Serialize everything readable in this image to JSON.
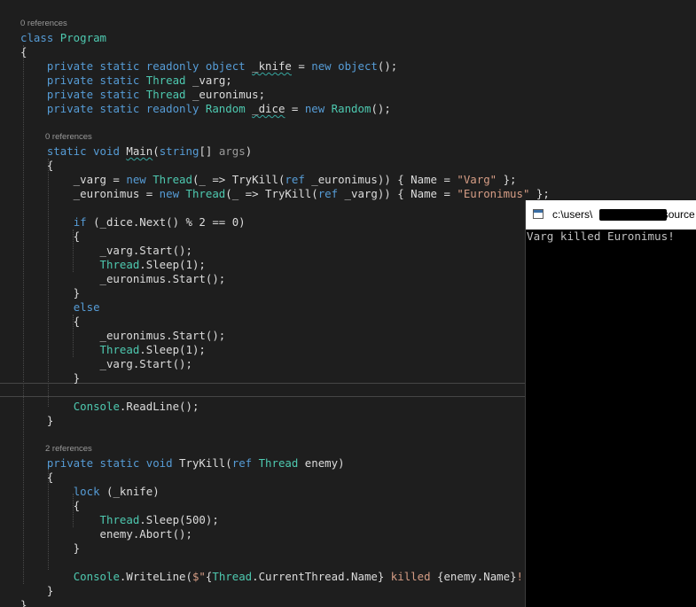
{
  "editor": {
    "colors": {
      "background": "#1e1e1e",
      "keyword": "#569cd6",
      "type": "#4ec9b0",
      "string": "#d69d85",
      "text": "#dcdcdc",
      "parameter": "#9b9b9b",
      "codelens": "#999999"
    },
    "lines": [
      {
        "tokens": [
          {
            "t": "0 references",
            "c": "lens"
          }
        ]
      },
      {
        "tokens": [
          {
            "t": "class ",
            "c": "kw"
          },
          {
            "t": "Program",
            "c": "type"
          }
        ]
      },
      {
        "tokens": [
          {
            "t": "{",
            "c": "p"
          }
        ]
      },
      {
        "tokens": [
          {
            "t": "    ",
            "c": "p"
          },
          {
            "t": "private static readonly object ",
            "c": "kw"
          },
          {
            "t": "_knife",
            "c": "sq"
          },
          {
            "t": " = ",
            "c": "p"
          },
          {
            "t": "new object",
            "c": "kw"
          },
          {
            "t": "();",
            "c": "p"
          }
        ]
      },
      {
        "tokens": [
          {
            "t": "    ",
            "c": "p"
          },
          {
            "t": "private static ",
            "c": "kw"
          },
          {
            "t": "Thread",
            "c": "type"
          },
          {
            "t": " _varg;",
            "c": "p"
          }
        ]
      },
      {
        "tokens": [
          {
            "t": "    ",
            "c": "p"
          },
          {
            "t": "private static ",
            "c": "kw"
          },
          {
            "t": "Thread",
            "c": "type"
          },
          {
            "t": " _euronimus;",
            "c": "p"
          }
        ]
      },
      {
        "tokens": [
          {
            "t": "    ",
            "c": "p"
          },
          {
            "t": "private static readonly ",
            "c": "kw"
          },
          {
            "t": "Random",
            "c": "type"
          },
          {
            "t": " ",
            "c": "p"
          },
          {
            "t": "_dice",
            "c": "sq"
          },
          {
            "t": " = ",
            "c": "p"
          },
          {
            "t": "new ",
            "c": "kw"
          },
          {
            "t": "Random",
            "c": "type"
          },
          {
            "t": "();",
            "c": "p"
          }
        ]
      },
      {
        "tokens": []
      },
      {
        "tokens": [
          {
            "t": "0 references",
            "c": "lens"
          }
        ]
      },
      {
        "tokens": [
          {
            "t": "    ",
            "c": "p"
          },
          {
            "t": "static void ",
            "c": "kw"
          },
          {
            "t": "Main",
            "c": "sqp"
          },
          {
            "t": "(",
            "c": "p"
          },
          {
            "t": "string",
            "c": "kw"
          },
          {
            "t": "[] ",
            "c": "p"
          },
          {
            "t": "args",
            "c": "param"
          },
          {
            "t": ")",
            "c": "p"
          }
        ]
      },
      {
        "tokens": [
          {
            "t": "    {",
            "c": "p"
          }
        ]
      },
      {
        "tokens": [
          {
            "t": "        _varg = ",
            "c": "p"
          },
          {
            "t": "new ",
            "c": "kw"
          },
          {
            "t": "Thread",
            "c": "type"
          },
          {
            "t": "(_ => TryKill(",
            "c": "p"
          },
          {
            "t": "ref",
            "c": "kw"
          },
          {
            "t": " _euronimus)) { Name = ",
            "c": "p"
          },
          {
            "t": "\"Varg\"",
            "c": "str"
          },
          {
            "t": " };",
            "c": "p"
          }
        ]
      },
      {
        "tokens": [
          {
            "t": "        _euronimus = ",
            "c": "p"
          },
          {
            "t": "new ",
            "c": "kw"
          },
          {
            "t": "Thread",
            "c": "type"
          },
          {
            "t": "(_ => TryKill(",
            "c": "p"
          },
          {
            "t": "ref",
            "c": "kw"
          },
          {
            "t": " _varg)) { Name = ",
            "c": "p"
          },
          {
            "t": "\"Euronimus\"",
            "c": "str"
          },
          {
            "t": " };",
            "c": "p"
          }
        ]
      },
      {
        "tokens": []
      },
      {
        "tokens": [
          {
            "t": "        ",
            "c": "p"
          },
          {
            "t": "if",
            "c": "kw"
          },
          {
            "t": " (_dice.Next() % 2 == 0)",
            "c": "p"
          }
        ]
      },
      {
        "tokens": [
          {
            "t": "        {",
            "c": "p"
          }
        ]
      },
      {
        "tokens": [
          {
            "t": "            _varg.Start();",
            "c": "p"
          }
        ]
      },
      {
        "tokens": [
          {
            "t": "            ",
            "c": "p"
          },
          {
            "t": "Thread",
            "c": "type"
          },
          {
            "t": ".Sleep(1);",
            "c": "p"
          }
        ]
      },
      {
        "tokens": [
          {
            "t": "            _euronimus.Start();",
            "c": "p"
          }
        ]
      },
      {
        "tokens": [
          {
            "t": "        }",
            "c": "p"
          }
        ]
      },
      {
        "tokens": [
          {
            "t": "        ",
            "c": "p"
          },
          {
            "t": "else",
            "c": "kw"
          }
        ]
      },
      {
        "tokens": [
          {
            "t": "        {",
            "c": "p"
          }
        ]
      },
      {
        "tokens": [
          {
            "t": "            _euronimus.Start();",
            "c": "p"
          }
        ]
      },
      {
        "tokens": [
          {
            "t": "            ",
            "c": "p"
          },
          {
            "t": "Thread",
            "c": "type"
          },
          {
            "t": ".Sleep(1);",
            "c": "p"
          }
        ]
      },
      {
        "tokens": [
          {
            "t": "            _varg.Start();",
            "c": "p"
          }
        ]
      },
      {
        "tokens": [
          {
            "t": "        }",
            "c": "p"
          }
        ]
      },
      {
        "tokens": []
      },
      {
        "tokens": [
          {
            "t": "        ",
            "c": "p"
          },
          {
            "t": "Console",
            "c": "type"
          },
          {
            "t": ".ReadLine();",
            "c": "p"
          }
        ]
      },
      {
        "tokens": [
          {
            "t": "    }",
            "c": "p"
          }
        ]
      },
      {
        "tokens": []
      },
      {
        "tokens": [
          {
            "t": "2 references",
            "c": "lens"
          }
        ]
      },
      {
        "tokens": [
          {
            "t": "    ",
            "c": "p"
          },
          {
            "t": "private static void ",
            "c": "kw"
          },
          {
            "t": "TryKill(",
            "c": "p"
          },
          {
            "t": "ref ",
            "c": "kw"
          },
          {
            "t": "Thread",
            "c": "type"
          },
          {
            "t": " enemy)",
            "c": "p"
          }
        ]
      },
      {
        "tokens": [
          {
            "t": "    {",
            "c": "p"
          }
        ]
      },
      {
        "tokens": [
          {
            "t": "        ",
            "c": "p"
          },
          {
            "t": "lock",
            "c": "kw"
          },
          {
            "t": " (_knife)",
            "c": "p"
          }
        ]
      },
      {
        "tokens": [
          {
            "t": "        {",
            "c": "p"
          }
        ]
      },
      {
        "tokens": [
          {
            "t": "            ",
            "c": "p"
          },
          {
            "t": "Thread",
            "c": "type"
          },
          {
            "t": ".Sleep(500);",
            "c": "p"
          }
        ]
      },
      {
        "tokens": [
          {
            "t": "            enemy.Abort();",
            "c": "p"
          }
        ]
      },
      {
        "tokens": [
          {
            "t": "        }",
            "c": "p"
          }
        ]
      },
      {
        "tokens": []
      },
      {
        "tokens": [
          {
            "t": "        ",
            "c": "p"
          },
          {
            "t": "Console",
            "c": "type"
          },
          {
            "t": ".WriteLine(",
            "c": "p"
          },
          {
            "t": "$\"",
            "c": "str"
          },
          {
            "t": "{",
            "c": "p"
          },
          {
            "t": "Thread",
            "c": "type"
          },
          {
            "t": ".CurrentThread.Name}",
            "c": "p"
          },
          {
            "t": " killed ",
            "c": "str"
          },
          {
            "t": "{enemy.Name}",
            "c": "p"
          },
          {
            "t": "!\"",
            "c": "str"
          },
          {
            "t": ");",
            "c": "p"
          }
        ]
      },
      {
        "tokens": [
          {
            "t": "    }",
            "c": "p"
          }
        ]
      },
      {
        "tokens": [
          {
            "t": "}",
            "c": "p"
          }
        ]
      }
    ]
  },
  "console": {
    "title_prefix": "c:\\users\\",
    "title_suffix": "\\source",
    "output": "Varg killed Euronimus!",
    "colors": {
      "background": "#000000",
      "text": "#c0c0c0",
      "titlebar": "#ffffff"
    },
    "icon": "console-window-icon"
  }
}
